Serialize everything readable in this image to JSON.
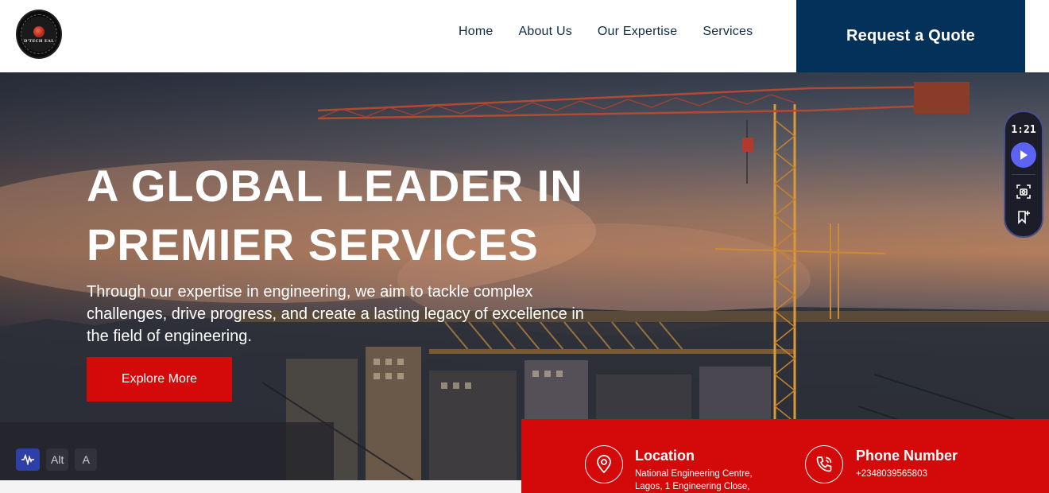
{
  "header": {
    "logo_text": "D'TECH EAL",
    "nav": [
      {
        "label": "Home"
      },
      {
        "label": "About Us"
      },
      {
        "label": "Our Expertise"
      },
      {
        "label": "Services"
      }
    ],
    "cta_label": "Request a Quote"
  },
  "hero": {
    "title_line1": "A GLOBAL LEADER IN",
    "title_line2": "PREMIER SERVICES",
    "subtitle": "Through our expertise in engineering, we aim to tackle complex challenges, drive progress, and create a lasting legacy of excellence in the field of engineering.",
    "button_label": "Explore More"
  },
  "accessibility": {
    "alt_label": "Alt",
    "a_label": "A"
  },
  "recorder": {
    "time": "1:21"
  },
  "info": {
    "location": {
      "title": "Location",
      "line1": "National Engineering Centre,",
      "line2": "Lagos, 1 Engineering Close,"
    },
    "phone": {
      "title": "Phone Number",
      "number": "+2348039565803"
    }
  },
  "colors": {
    "brand_navy": "#04315a",
    "brand_red": "#d40909",
    "nav_text": "#0f2b45"
  }
}
